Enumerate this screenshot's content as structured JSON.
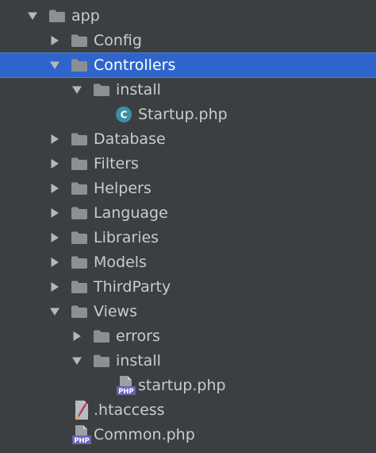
{
  "tree": [
    {
      "label": "app",
      "type": "folder",
      "depth": 0,
      "expanded": true,
      "selected": false
    },
    {
      "label": "Config",
      "type": "folder",
      "depth": 1,
      "expanded": false,
      "selected": false
    },
    {
      "label": "Controllers",
      "type": "folder",
      "depth": 1,
      "expanded": true,
      "selected": true
    },
    {
      "label": "install",
      "type": "folder",
      "depth": 2,
      "expanded": true,
      "selected": false
    },
    {
      "label": "Startup.php",
      "type": "php-class",
      "depth": 3,
      "selected": false
    },
    {
      "label": "Database",
      "type": "folder",
      "depth": 1,
      "expanded": false,
      "selected": false
    },
    {
      "label": "Filters",
      "type": "folder",
      "depth": 1,
      "expanded": false,
      "selected": false
    },
    {
      "label": "Helpers",
      "type": "folder",
      "depth": 1,
      "expanded": false,
      "selected": false
    },
    {
      "label": "Language",
      "type": "folder",
      "depth": 1,
      "expanded": false,
      "selected": false
    },
    {
      "label": "Libraries",
      "type": "folder",
      "depth": 1,
      "expanded": false,
      "selected": false
    },
    {
      "label": "Models",
      "type": "folder",
      "depth": 1,
      "expanded": false,
      "selected": false
    },
    {
      "label": "ThirdParty",
      "type": "folder",
      "depth": 1,
      "expanded": false,
      "selected": false
    },
    {
      "label": "Views",
      "type": "folder",
      "depth": 1,
      "expanded": true,
      "selected": false
    },
    {
      "label": "errors",
      "type": "folder",
      "depth": 2,
      "expanded": false,
      "selected": false
    },
    {
      "label": "install",
      "type": "folder",
      "depth": 2,
      "expanded": true,
      "selected": false
    },
    {
      "label": "startup.php",
      "type": "php-file",
      "depth": 3,
      "selected": false
    },
    {
      "label": ".htaccess",
      "type": "htaccess-file",
      "depth": 1,
      "selected": false
    },
    {
      "label": "Common.php",
      "type": "php-file",
      "depth": 1,
      "selected": false
    }
  ],
  "icons": {
    "php_badge": "PHP",
    "class_badge": "C"
  },
  "colors": {
    "background": "#3c3f41",
    "selection": "#2f65ca",
    "text": "#c9ccce",
    "folder": "#8c9095",
    "arrow": "#b4b8bc",
    "class_icon": "#3d8fa6",
    "php_icon": "#6e5fb8"
  }
}
